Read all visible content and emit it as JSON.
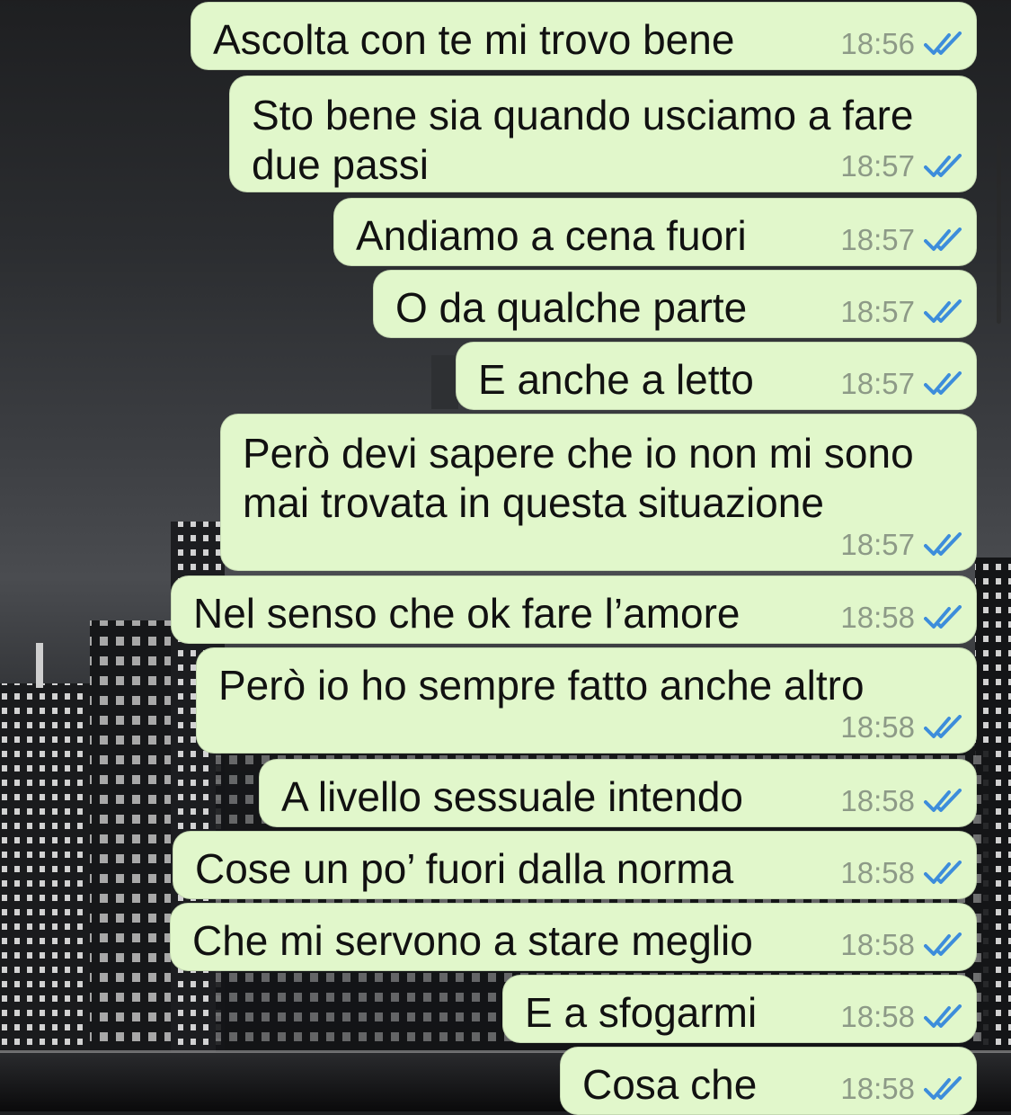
{
  "colors": {
    "bubble": "#e1f7cb",
    "text": "#111111",
    "time": "#8d9a87",
    "read_ticks": "#3d8ddb"
  },
  "messages": [
    {
      "text": "Ascolta con te mi trovo bene",
      "time": "18:56",
      "status": "read-double-check-icon"
    },
    {
      "text": "Sto bene sia quando usciamo a fare due passi",
      "time": "18:57",
      "status": "read-double-check-icon"
    },
    {
      "text": "Andiamo a cena fuori",
      "time": "18:57",
      "status": "read-double-check-icon"
    },
    {
      "text": "O da qualche parte",
      "time": "18:57",
      "status": "read-double-check-icon"
    },
    {
      "text": "E anche a letto",
      "time": "18:57",
      "status": "read-double-check-icon"
    },
    {
      "text": "Però devi sapere che io non mi sono mai trovata in questa situazione",
      "time": "18:57",
      "status": "read-double-check-icon"
    },
    {
      "text": "Nel senso che ok fare l’amore",
      "time": "18:58",
      "status": "read-double-check-icon"
    },
    {
      "text": "Però io ho sempre fatto anche altro",
      "time": "18:58",
      "status": "read-double-check-icon"
    },
    {
      "text": "A livello sessuale intendo",
      "time": "18:58",
      "status": "read-double-check-icon"
    },
    {
      "text": "Cose un po’ fuori dalla norma",
      "time": "18:58",
      "status": "read-double-check-icon"
    },
    {
      "text": "Che mi servono a stare meglio",
      "time": "18:58",
      "status": "read-double-check-icon"
    },
    {
      "text": "E a sfogarmi",
      "time": "18:58",
      "status": "read-double-check-icon"
    },
    {
      "text": "Cosa che",
      "time": "18:58",
      "status": "read-double-check-icon"
    }
  ]
}
